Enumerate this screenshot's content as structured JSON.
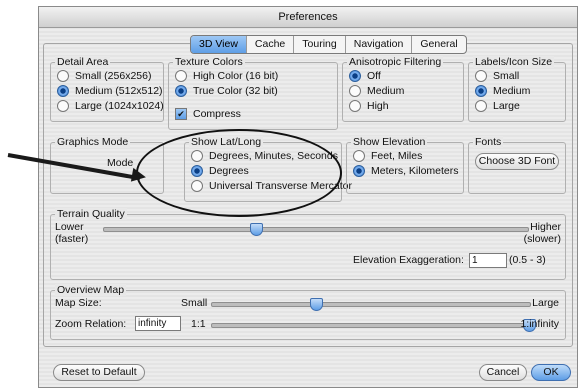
{
  "window": {
    "title": "Preferences"
  },
  "tabs": [
    {
      "label": "3D View",
      "active": true
    },
    {
      "label": "Cache"
    },
    {
      "label": "Touring"
    },
    {
      "label": "Navigation"
    },
    {
      "label": "General"
    }
  ],
  "detail_area": {
    "legend": "Detail Area",
    "options": [
      "Small (256x256)",
      "Medium (512x512)",
      "Large (1024x1024)"
    ],
    "selected": "Medium (512x512)"
  },
  "texture_colors": {
    "legend": "Texture Colors",
    "options": [
      "High Color (16 bit)",
      "True Color (32 bit)"
    ],
    "selected": "True Color (32 bit)",
    "compress_label": "Compress",
    "compress_checked": true
  },
  "anisotropic": {
    "legend": "Anisotropic Filtering",
    "options": [
      "Off",
      "Medium",
      "High"
    ],
    "selected": "Off"
  },
  "labels_icon": {
    "legend": "Labels/Icon Size",
    "options": [
      "Small",
      "Medium",
      "Large"
    ],
    "selected": "Medium"
  },
  "graphics_mode": {
    "legend": "Graphics Mode",
    "option_fragment": "Mode"
  },
  "show_latlong": {
    "legend": "Show Lat/Long",
    "options": [
      "Degrees, Minutes, Seconds",
      "Degrees",
      "Universal Transverse Mercator"
    ],
    "selected": "Degrees"
  },
  "show_elevation": {
    "legend": "Show Elevation",
    "options": [
      "Feet, Miles",
      "Meters, Kilometers"
    ],
    "selected": "Meters, Kilometers"
  },
  "fonts": {
    "legend": "Fonts",
    "button_label": "Choose 3D Font"
  },
  "terrain": {
    "legend": "Terrain Quality",
    "low_label_1": "Lower",
    "low_label_2": "(faster)",
    "high_label_1": "Higher",
    "high_label_2": "(slower)",
    "slider_value": 0.36,
    "elevation_label": "Elevation Exaggeration:",
    "elevation_value": "1",
    "elevation_range": "(0.5 - 3)"
  },
  "overview": {
    "legend": "Overview Map",
    "map_size_label": "Map Size:",
    "small_label": "Small",
    "large_label": "Large",
    "map_size_value": 0.33,
    "zoom_label": "Zoom Relation:",
    "zoom_value": "infinity",
    "zoom_low": "1:1",
    "zoom_high": "1:infinity",
    "zoom_slider_value": 1.0
  },
  "buttons": {
    "reset": "Reset to Default",
    "cancel": "Cancel",
    "ok": "OK"
  }
}
